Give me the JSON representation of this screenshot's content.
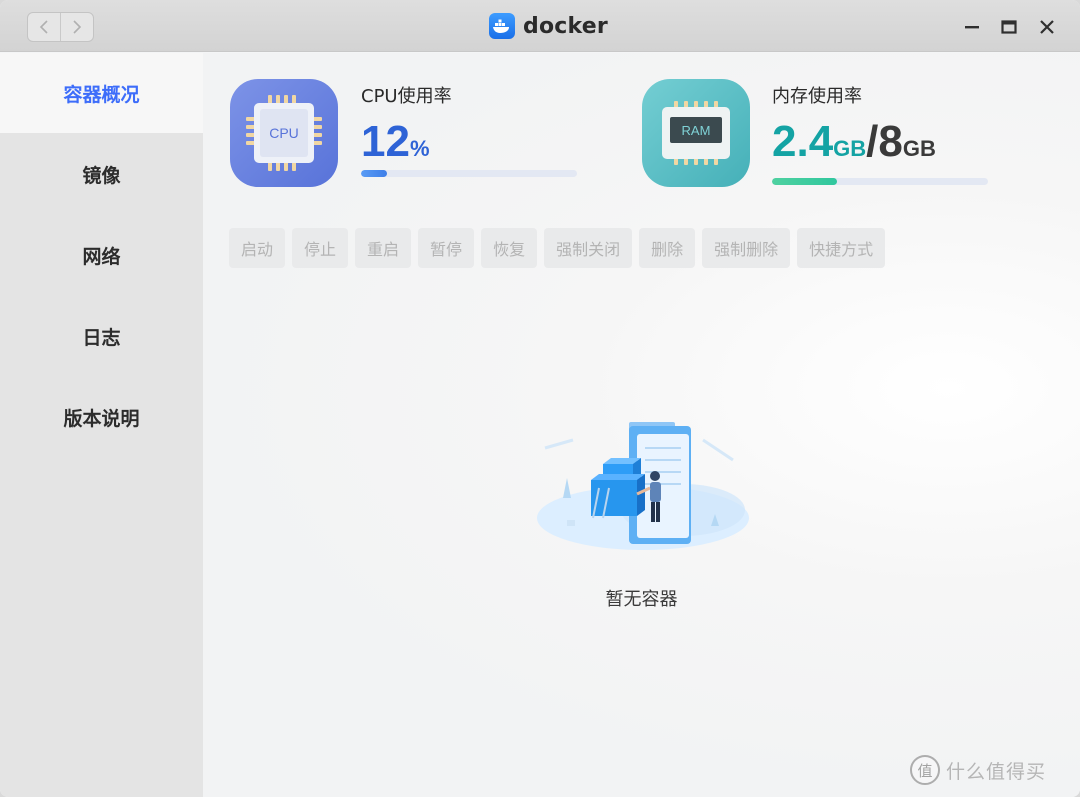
{
  "window": {
    "title": "docker"
  },
  "nav": {
    "back_icon": "chevron-left-icon",
    "forward_icon": "chevron-right-icon"
  },
  "window_controls": [
    "minimize-icon",
    "maximize-icon",
    "close-icon"
  ],
  "sidebar": {
    "items": [
      {
        "label": "容器概况",
        "active": true
      },
      {
        "label": "镜像",
        "active": false
      },
      {
        "label": "网络",
        "active": false
      },
      {
        "label": "日志",
        "active": false
      },
      {
        "label": "版本说明",
        "active": false
      }
    ]
  },
  "cpu": {
    "label": "CPU使用率",
    "value": "12",
    "unit": "%",
    "icon_text": "CPU",
    "usage_fraction": 0.12
  },
  "memory": {
    "label": "内存使用率",
    "used": "2.4",
    "used_unit": "GB",
    "separator": "/",
    "total": "8",
    "total_unit": "GB",
    "icon_text": "RAM",
    "usage_fraction": 0.3
  },
  "toolbar": {
    "buttons": [
      "启动",
      "停止",
      "重启",
      "暂停",
      "恢复",
      "强制关闭",
      "删除",
      "强制删除",
      "快捷方式"
    ]
  },
  "empty_state": {
    "text": "暂无容器"
  },
  "watermark": {
    "glyph": "值",
    "text": "什么值得买"
  },
  "colors": {
    "accent": "#3d6dfa",
    "cpu_value": "#2e63d6",
    "mem_value": "#14a3a4"
  }
}
